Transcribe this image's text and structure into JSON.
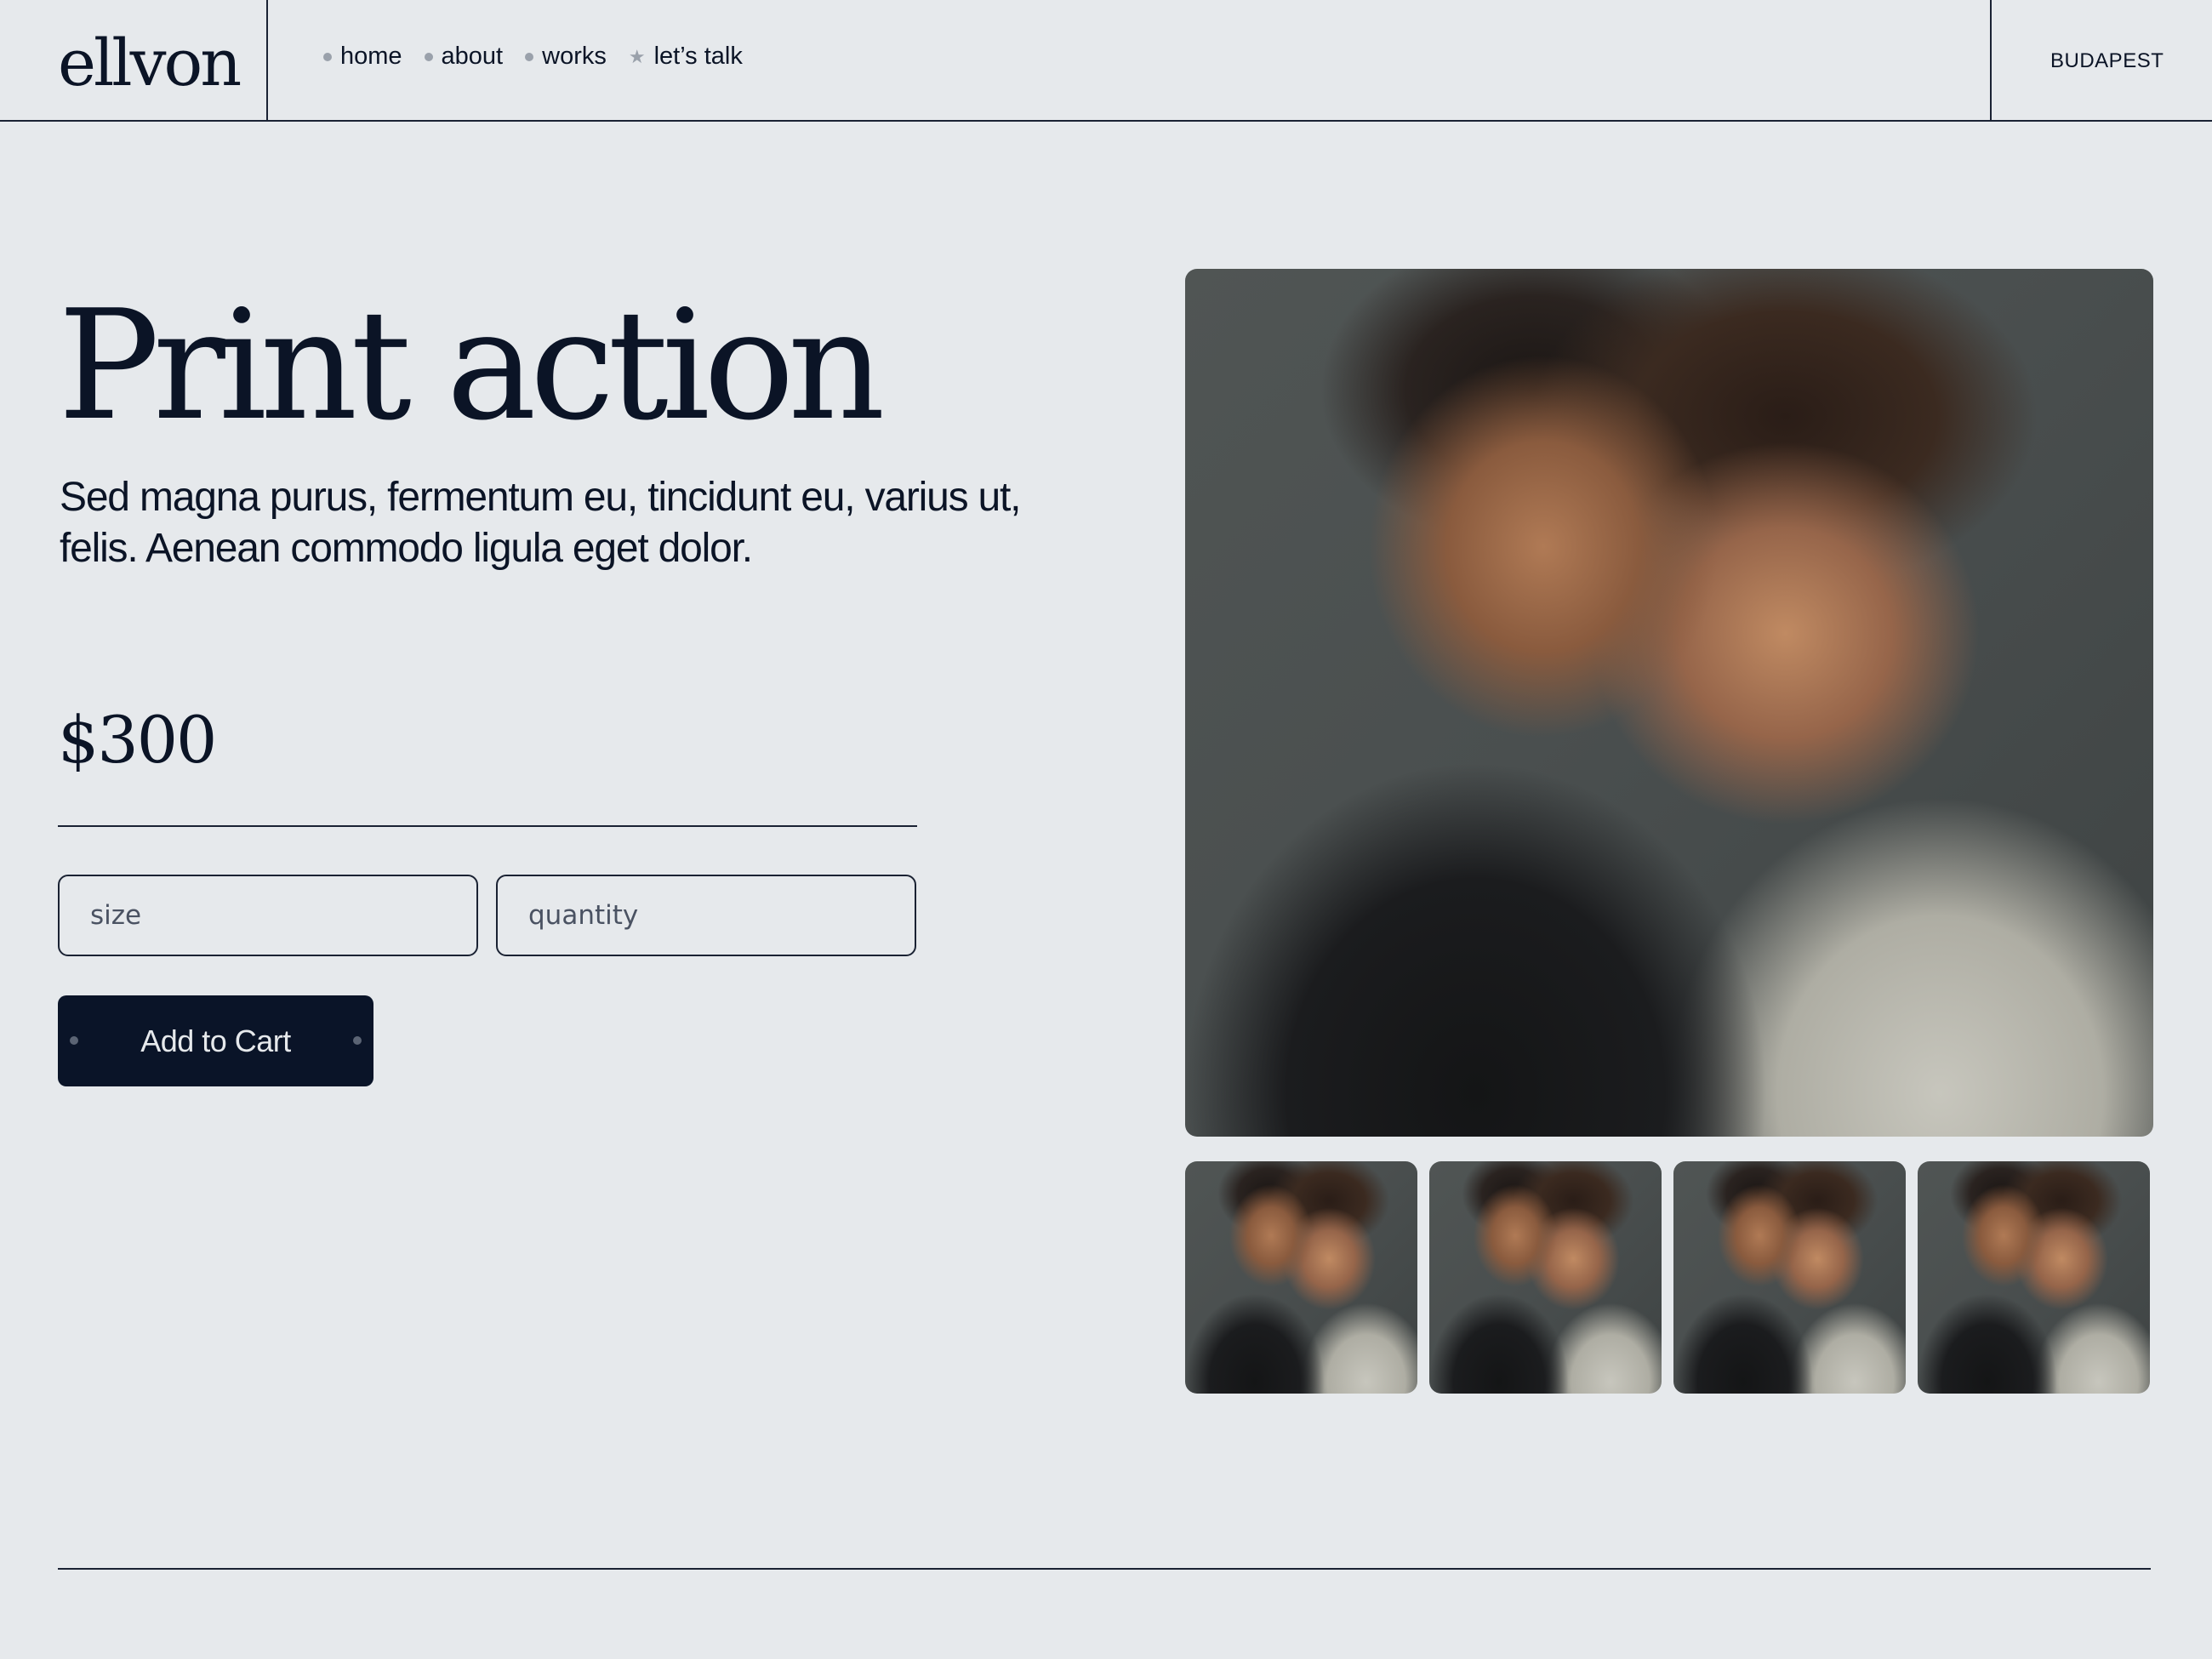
{
  "brand": {
    "logo_text": "ellvon"
  },
  "nav": {
    "items": [
      {
        "label": "home",
        "marker": "dot"
      },
      {
        "label": "about",
        "marker": "dot"
      },
      {
        "label": "works",
        "marker": "dot"
      },
      {
        "label": "let’s talk",
        "marker": "star"
      }
    ]
  },
  "header": {
    "location": "BUDAPEST"
  },
  "product": {
    "title": "Print action",
    "description": "Sed magna purus, fermentum eu, tincidunt eu, varius ut, felis. Aenean commodo ligula eget dolor.",
    "price": "$300",
    "size_placeholder": "size",
    "quantity_placeholder": "quantity",
    "add_to_cart_label": "Add to Cart"
  },
  "gallery": {
    "thumbnail_count": 4
  },
  "colors": {
    "background": "#e6e9ec",
    "text": "#0b1426",
    "button": "#0a1428",
    "marker": "#9aa1ab"
  }
}
